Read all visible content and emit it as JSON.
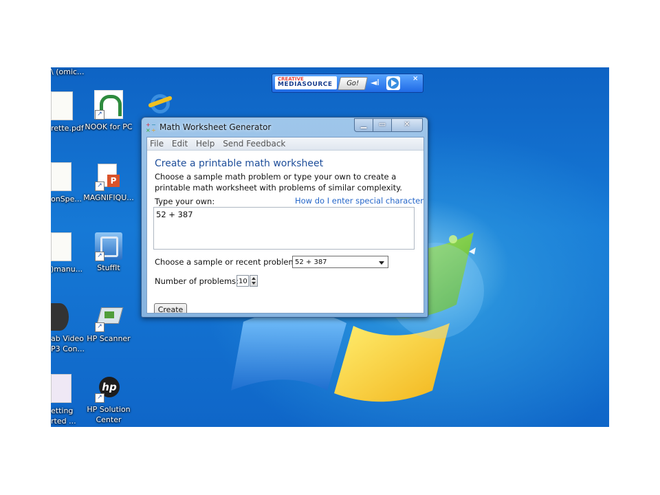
{
  "desktop": {
    "icons": [
      {
        "label1": "\\ (omic...",
        "label2": ""
      },
      {
        "label1": "rette.pdf",
        "label2": ""
      },
      {
        "label1": "NOOK for PC",
        "label2": ""
      },
      {
        "label1": "onSpe...",
        "label2": ""
      },
      {
        "label1": "MAGNIFIQU...",
        "label2": ""
      },
      {
        "label1": ")manu...",
        "label2": ""
      },
      {
        "label1": "StuffIt",
        "label2": ""
      },
      {
        "label1": "ab Video",
        "label2": "P3 Con..."
      },
      {
        "label1": "HP Scanner",
        "label2": ""
      },
      {
        "label1": "etting",
        "label2": "rted ..."
      },
      {
        "label1": "HP Solution",
        "label2": "Center"
      }
    ]
  },
  "media_bar": {
    "logo_top": "CREATIVE",
    "logo_bottom": "MEDIASOURCE",
    "go_label": "Go!",
    "close_label": "×"
  },
  "window": {
    "title": "Math Worksheet Generator",
    "menu": [
      "File",
      "Edit",
      "Help",
      "Send Feedback"
    ],
    "heading": "Create a printable math worksheet",
    "description": "Choose a sample math problem or type your own to create a printable math worksheet with problems of similar complexity.",
    "type_own_label": "Type your own:",
    "help_link": "How do I enter special character",
    "problem_text": "52 + 387",
    "sample_label": "Choose a sample or recent problem:",
    "sample_value": "52 + 387",
    "num_label": "Number of problems:",
    "num_value": "10",
    "create_label": "Create"
  }
}
